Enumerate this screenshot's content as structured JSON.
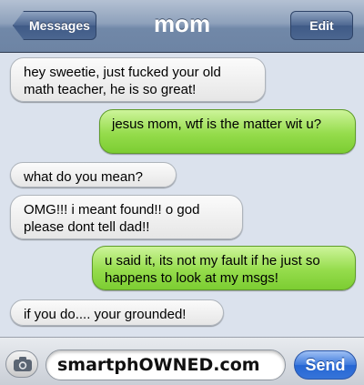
{
  "header": {
    "back_label": "Messages",
    "title": "mom",
    "edit_label": "Edit"
  },
  "messages": [
    {
      "direction": "received",
      "text": "hey sweetie, just fucked your old math teacher, he is so great!"
    },
    {
      "direction": "sent",
      "text": "jesus mom, wtf is the matter wit u?"
    },
    {
      "direction": "received",
      "text": "what do you mean?"
    },
    {
      "direction": "received",
      "text": "OMG!!! i meant found!! o god please dont tell dad!!"
    },
    {
      "direction": "sent",
      "text": "u said it, its not my fault if he just so happens to look at my msgs!"
    },
    {
      "direction": "received",
      "text": "if you do.... your grounded!"
    }
  ],
  "input_bar": {
    "camera_icon": "camera-icon",
    "field_value": "smartphOWNED.com",
    "send_label": "Send"
  },
  "colors": {
    "sent_bubble": "#95dc4c",
    "received_bubble": "#e6e6e6",
    "navbar": "#7188a8",
    "send_button": "#3d79dc"
  }
}
